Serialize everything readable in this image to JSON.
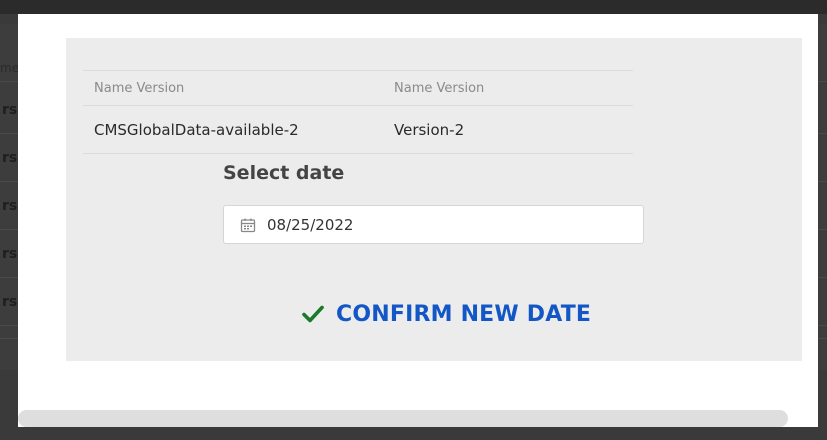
{
  "background": {
    "header_fragment": "me",
    "row_fragment": "rsi"
  },
  "modal": {
    "close_symbol": "×",
    "table": {
      "headers": [
        "Name Version",
        "Name Version"
      ],
      "rows": [
        {
          "name": "CMSGlobalData-available-2",
          "version": "Version-2"
        }
      ]
    },
    "select_date_label": "Select date",
    "date_value": "08/25/2022",
    "confirm_label": "CONFIRM NEW DATE"
  },
  "colors": {
    "confirm_text": "#1357c6",
    "check": "#1a7a2a",
    "panel": "#ececec"
  },
  "icons": {
    "calendar": "calendar-icon",
    "check": "check-icon",
    "close": "close-icon"
  }
}
